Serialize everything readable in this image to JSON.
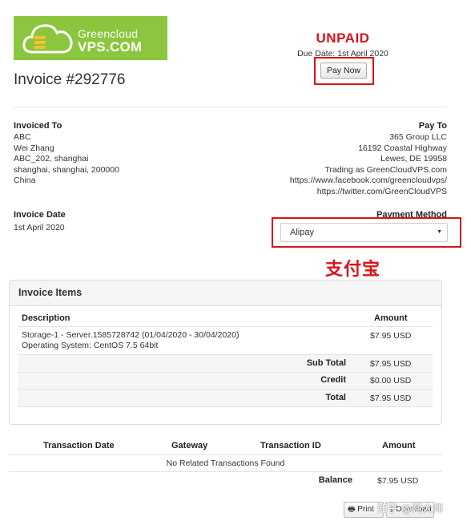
{
  "logo": {
    "line1": "Greencloud",
    "line2": "VPS.COM"
  },
  "invoice": {
    "title": "Invoice #292776",
    "status": "UNPAID",
    "due_date": "Due Date: 1st April 2020",
    "pay_now": "Pay Now"
  },
  "invoiced_to": {
    "label": "Invoiced To",
    "lines": [
      "ABC",
      "Wei Zhang",
      "ABC_202, shanghai",
      "shanghai, shanghai, 200000",
      "China"
    ]
  },
  "pay_to": {
    "label": "Pay To",
    "lines": [
      "365 Group LLC",
      "16192 Coastal Highway",
      "Lewes, DE 19958",
      "Trading as GreenCloudVPS.com",
      "https://www.facebook.com/greencloudvps/",
      "https://twitter.com/GreenCloudVPS"
    ]
  },
  "invoice_date": {
    "label": "Invoice Date",
    "value": "1st April 2020"
  },
  "payment_method": {
    "label": "Payment Method",
    "selected": "Alipay",
    "annotation": "支付宝"
  },
  "items": {
    "title": "Invoice Items",
    "headers": {
      "description": "Description",
      "amount": "Amount"
    },
    "rows": [
      {
        "description_line1": "Storage-1 - Server.1585728742 (01/04/2020 - 30/04/2020)",
        "description_line2": "Operating System: CentOS 7.5 64bit",
        "amount": "$7.95 USD"
      }
    ],
    "totals": [
      {
        "label": "Sub Total",
        "value": "$7.95 USD"
      },
      {
        "label": "Credit",
        "value": "$0.00 USD"
      },
      {
        "label": "Total",
        "value": "$7.95 USD"
      }
    ]
  },
  "transactions": {
    "headers": {
      "date": "Transaction Date",
      "gateway": "Gateway",
      "id": "Transaction ID",
      "amount": "Amount"
    },
    "empty": "No Related Transactions Found",
    "balance_label": "Balance",
    "balance_value": "$7.95 USD"
  },
  "footer": {
    "print": "Print",
    "download": "Download",
    "watermark": "知乎 @阿大师"
  },
  "colors": {
    "brand_green": "#8cc63e",
    "unpaid_red": "#d7141a"
  }
}
